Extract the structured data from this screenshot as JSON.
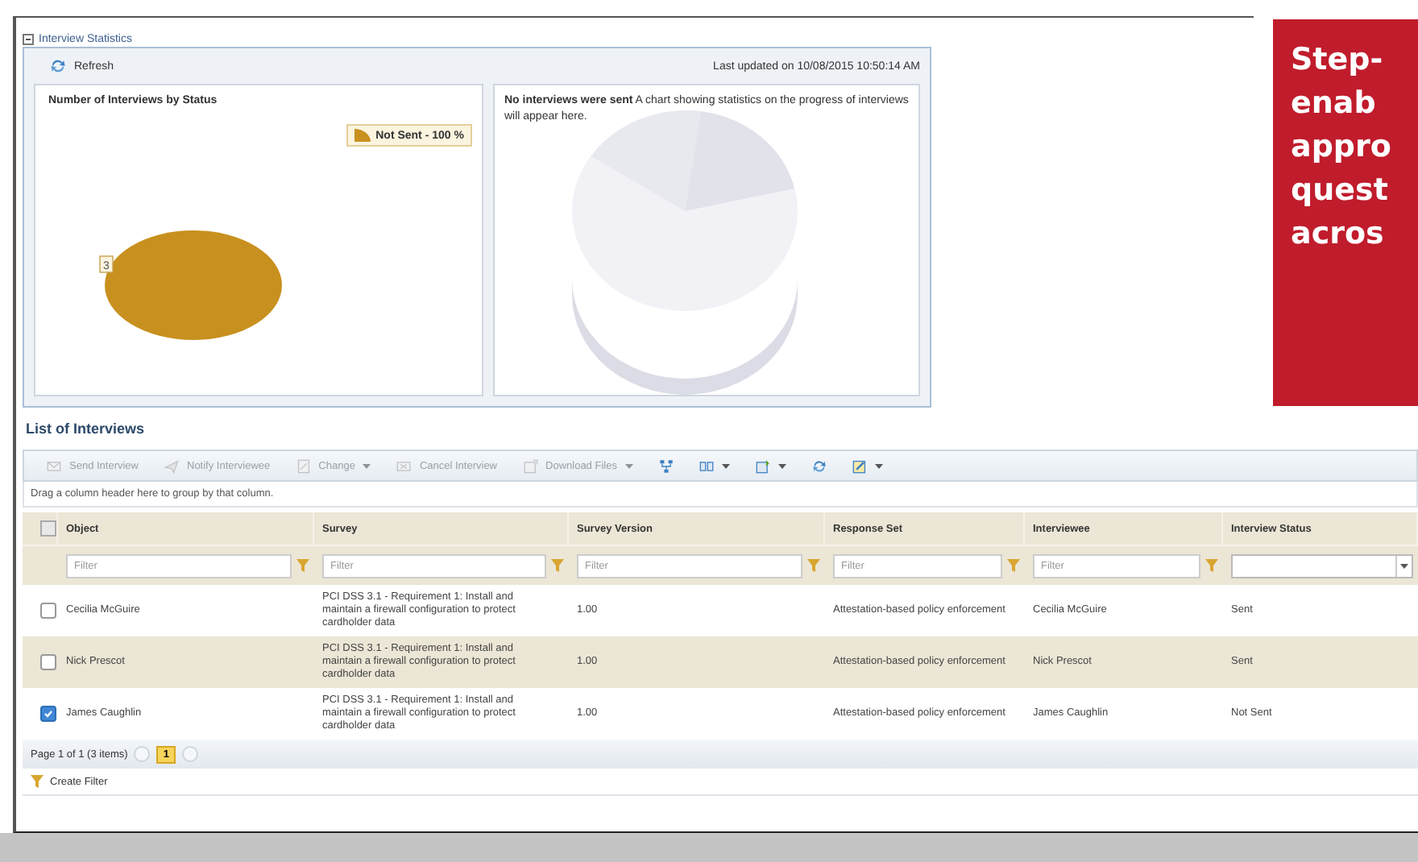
{
  "statistics": {
    "title": "Interview Statistics",
    "expanded": true,
    "refresh": "Refresh",
    "last_updated": "Last updated on 10/08/2015 10:50:14 AM",
    "status_chart": {
      "title": "Number of Interviews by Status",
      "legend": "Not Sent - 100 %",
      "chart_data": {
        "type": "pie",
        "series": [
          {
            "color": "#c8901e",
            "values": [
              3
            ]
          }
        ],
        "data_labels": true
      }
    },
    "progress_chart": {
      "message": "**No interviews were sent** A chart showing statistics on the progress of interviews will appear here."
    }
  },
  "list": {
    "title": "List of Interviews",
    "toolbar": [
      {
        "kind": "text",
        "label": "Send Interview",
        "disabled": true,
        "dropdown": false
      },
      {
        "kind": "text",
        "label": "Notify Interviewee",
        "disabled": true,
        "dropdown": false
      },
      {
        "kind": "text",
        "label": "Change",
        "disabled": true,
        "dropdown": true
      },
      {
        "kind": "text",
        "label": "Cancel Interview",
        "disabled": true,
        "dropdown": false
      },
      {
        "kind": "text",
        "label": "Download Files",
        "disabled": true,
        "dropdown": true
      },
      {
        "kind": "icon",
        "disabled": false,
        "dropdown": false
      },
      {
        "kind": "icon",
        "disabled": false,
        "dropdown": true
      },
      {
        "kind": "icon",
        "disabled": false,
        "dropdown": true
      },
      {
        "kind": "icon",
        "disabled": false,
        "dropdown": false
      },
      {
        "kind": "icon",
        "disabled": false,
        "dropdown": true
      }
    ],
    "group_hint": "Drag a column header here to group by that column.",
    "all_selected": false,
    "columns": [
      {
        "label": "Object",
        "kind": "text",
        "placeholder": "Filter"
      },
      {
        "label": "Survey",
        "kind": "text",
        "placeholder": "Filter"
      },
      {
        "label": "Survey Version",
        "kind": "text",
        "placeholder": "Filter"
      },
      {
        "label": "Response Set",
        "kind": "text",
        "placeholder": "Filter"
      },
      {
        "label": "Interviewee",
        "kind": "text",
        "placeholder": "Filter"
      },
      {
        "label": "Interview Status",
        "kind": "select"
      }
    ],
    "rows": [
      {
        "selected": false,
        "cells": [
          "Cecilia McGuire",
          "PCI DSS 3.1 - Requirement 1: Install and maintain a firewall configuration to protect cardholder data",
          "1.00",
          "Attestation-based policy enforcement",
          "Cecilia McGuire",
          "Sent"
        ]
      },
      {
        "selected": false,
        "cells": [
          "Nick Prescot",
          "PCI DSS 3.1 - Requirement 1: Install and maintain a firewall configuration to protect cardholder data",
          "1.00",
          "Attestation-based policy enforcement",
          "Nick Prescot",
          "Sent"
        ]
      },
      {
        "selected": true,
        "cells": [
          "James Caughlin",
          "PCI DSS 3.1 - Requirement 1: Install and maintain a firewall configuration to protect cardholder data",
          "1.00",
          "Attestation-based policy enforcement",
          "James Caughlin",
          "Not Sent"
        ]
      }
    ],
    "pager": {
      "summary": "Page 1 of 1 (3 items)",
      "pages": [
        {
          "label": "1",
          "selected": true
        }
      ]
    },
    "create_filter": "Create Filter"
  },
  "callout": {
    "lines": [
      "Step-",
      "enab",
      "appro",
      "quest",
      "acros"
    ]
  }
}
